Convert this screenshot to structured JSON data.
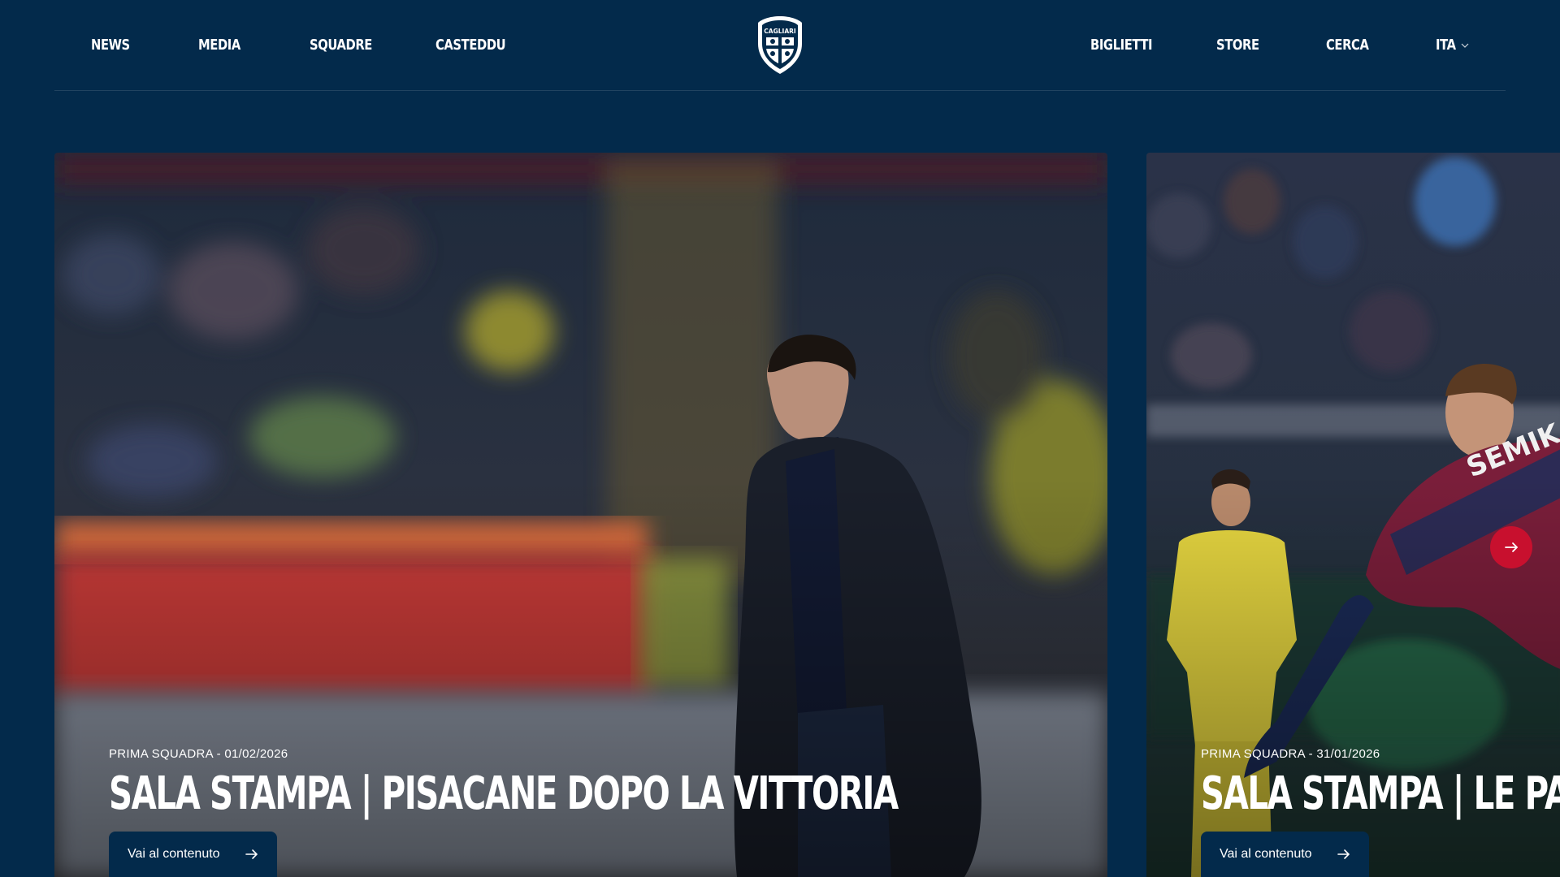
{
  "nav": {
    "left": [
      {
        "label": "NEWS"
      },
      {
        "label": "MEDIA"
      },
      {
        "label": "SQUADRE"
      },
      {
        "label": "CASTEDDU"
      }
    ],
    "right": [
      {
        "label": "BIGLIETTI"
      },
      {
        "label": "STORE"
      },
      {
        "label": "CERCA"
      },
      {
        "label": "ITA"
      }
    ],
    "logo_text": "CAGLIARI"
  },
  "slides": [
    {
      "category": "PRIMA SQUADRA - 01/02/2026",
      "title": "SALA STAMPA | PISACANE DOPO LA VITTORIA",
      "cta_label": "Vai al contenuto"
    },
    {
      "category": "PRIMA SQUADRA - 31/01/2026",
      "title": "SALA STAMPA | LE PAROLE DEL MATCH",
      "cta_label": "Vai al contenuto"
    }
  ],
  "colors": {
    "background": "#032a4b",
    "accent": "#c8102e",
    "text": "#ffffff"
  },
  "icons": {
    "cta": "arrow-right-icon",
    "next": "arrow-right-icon",
    "language": "chevron-down-icon"
  }
}
